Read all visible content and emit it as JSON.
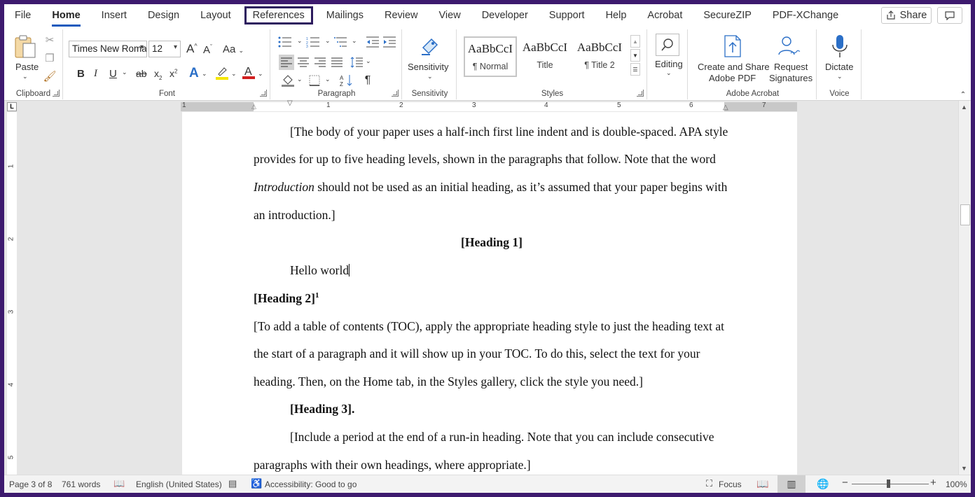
{
  "menu": {
    "items": [
      "File",
      "Home",
      "Insert",
      "Design",
      "Layout",
      "References",
      "Mailings",
      "Review",
      "View",
      "Developer",
      "Support",
      "Help",
      "Acrobat",
      "SecureZIP",
      "PDF-XChange"
    ],
    "active": "Home",
    "highlighted": "References",
    "share_label": "Share"
  },
  "ribbon": {
    "clipboard": {
      "label": "Clipboard",
      "paste_label": "Paste"
    },
    "font": {
      "label": "Font",
      "font_name": "Times New Roma",
      "font_size": "12",
      "bold": "B",
      "italic": "I",
      "underline": "U",
      "strike": "ab",
      "subscript": "x",
      "superscript": "x",
      "case": "Aa",
      "grow": "A",
      "shrink": "A"
    },
    "paragraph": {
      "label": "Paragraph"
    },
    "sensitivity": {
      "label": "Sensitivity",
      "button_label": "Sensitivity"
    },
    "styles": {
      "label": "Styles",
      "items": [
        {
          "sample": "AaBbCcI",
          "name": "¶ Normal"
        },
        {
          "sample": "AaBbCcI",
          "name": "Title"
        },
        {
          "sample": "AaBbCcI",
          "name": "¶ Title 2"
        }
      ]
    },
    "editing": {
      "label": "Editing"
    },
    "adobe": {
      "label": "Adobe Acrobat",
      "create_label": "Create and Share",
      "create_label2": "Adobe PDF",
      "request_label": "Request",
      "request_label2": "Signatures"
    },
    "voice": {
      "label": "Voice",
      "dictate_label": "Dictate"
    }
  },
  "ruler": {
    "numbers": [
      "1",
      "1",
      "2",
      "3",
      "4",
      "5",
      "6",
      "7"
    ]
  },
  "vruler": {
    "numbers": [
      "1",
      "2",
      "3",
      "4",
      "5"
    ]
  },
  "document": {
    "lines": [
      "[The body of your paper uses a half-inch first line indent and is double-spaced.  APA style",
      "provides for up to five heading levels, shown in the paragraphs that follow.  Note that the word",
      "should not be used as an initial heading, as it’s assumed that your paper begins with",
      "an introduction.]",
      "[Heading 1]",
      "Hello world",
      "[Heading 2]",
      "[To add a table of contents (TOC), apply the appropriate heading style to just the heading text at",
      "the start of a paragraph and it will show up in your TOC.  To do this, select the text for your",
      "heading.  Then, on the Home tab, in the Styles gallery, click the style you need.]",
      "[Heading 3].",
      "[Include a period at the end of a run-in heading.  Note that you can include consecutive",
      "paragraphs with their own headings, where appropriate.]"
    ],
    "intro_word": "Introduction",
    "footnote_ref": "1"
  },
  "status": {
    "page": "Page 3 of 8",
    "words": "761 words",
    "language": "English (United States)",
    "accessibility": "Accessibility: Good to go",
    "focus": "Focus",
    "zoom": "100%"
  }
}
